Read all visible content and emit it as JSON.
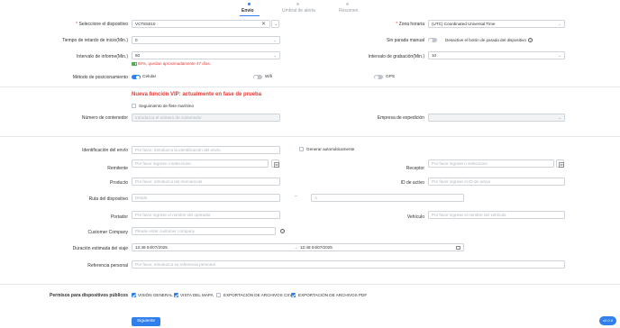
{
  "steps": [
    {
      "label": "Envío",
      "active": true
    },
    {
      "label": "Umbral de alerta",
      "active": false
    },
    {
      "label": "Resumen",
      "active": false
    }
  ],
  "form": {
    "device": {
      "label": "Seleccione el dispositivo",
      "value": "VCTE5010"
    },
    "timezone": {
      "label": "Zona horaria",
      "value": "(UTC) Coordinated Universal Time"
    },
    "start_delay": {
      "label": "Tiempo de retardo de inicio(Min.)",
      "value": "0"
    },
    "no_stop": {
      "label": "Sin parada manual",
      "desc": "Desactive el botón de parada del dispositivo"
    },
    "report_interval": {
      "label": "Intervalo de informe(Min.)",
      "value": "60",
      "battery": "60%, quedan aproximadamente 47 días."
    },
    "record_interval": {
      "label": "Intervalo de grabación(Min.)",
      "value": "10"
    },
    "positioning": {
      "label": "Método de posicionamiento",
      "options": [
        "Celular",
        "Wifi",
        "GPS"
      ]
    },
    "vip_title": "Nueva función VIP: actualmente en fase de prueba",
    "maritime": {
      "label": "Seguimiento de flete marítimo"
    },
    "container": {
      "label": "Número de contenedor",
      "placeholder": "Introduzca el número de contenedor"
    },
    "shipping_company": {
      "label": "Empresa de expedición",
      "value": ""
    },
    "shipment_id": {
      "label": "Identificación del envío",
      "placeholder": "Por favor, introduzca la identificación del envío"
    },
    "auto_generate": {
      "label": "Generar automáticamente"
    },
    "sender": {
      "label": "Remitente",
      "placeholder": "Por favor ingrese o seleccione"
    },
    "receiver": {
      "label": "Receptor",
      "placeholder": "Por favor ingrese o seleccione"
    },
    "product": {
      "label": "Producto",
      "placeholder": "Por favor, introduzca las mercancías"
    },
    "asset_id": {
      "label": "ID de activo",
      "placeholder": "Por favor ingrese el ID de activo"
    },
    "route": {
      "label": "Ruta del dispositivo",
      "from_placeholder": "Desde",
      "to_placeholder": "A",
      "dash": "–"
    },
    "carrier": {
      "label": "Portador",
      "placeholder": "Por favor ingrese el nombre del operador"
    },
    "vehicle": {
      "label": "Vehículo",
      "placeholder": "Por favor ingrese el nombre del vehículo"
    },
    "customer_company": {
      "label": "Customer Company",
      "placeholder": "Please enter customer company"
    },
    "trip_duration": {
      "label": "Duración estimada del viaje",
      "start": "12:48 04/07/2025",
      "end": "12:48 04/07/2025"
    },
    "reference": {
      "label": "Referencia personal",
      "placeholder": "Por favor, introduzca su referencia personal"
    }
  },
  "permissions": {
    "label": "Permisos para dispositivos públicos",
    "items": [
      {
        "label": "VISIÓN GENERAL",
        "checked": true
      },
      {
        "label": "VISTA DEL MAPA",
        "checked": true
      },
      {
        "label": "EXPORTACIÓN DE ARCHIVOS CSV",
        "checked": false
      },
      {
        "label": "EXPORTACIÓN DE ARCHIVOS PDF",
        "checked": true
      }
    ]
  },
  "footer": {
    "next": "Siguiente",
    "user": "v2.0.0"
  },
  "colors": {
    "primary": "#2f80ed",
    "danger": "#e53935",
    "success": "#4caf50"
  }
}
